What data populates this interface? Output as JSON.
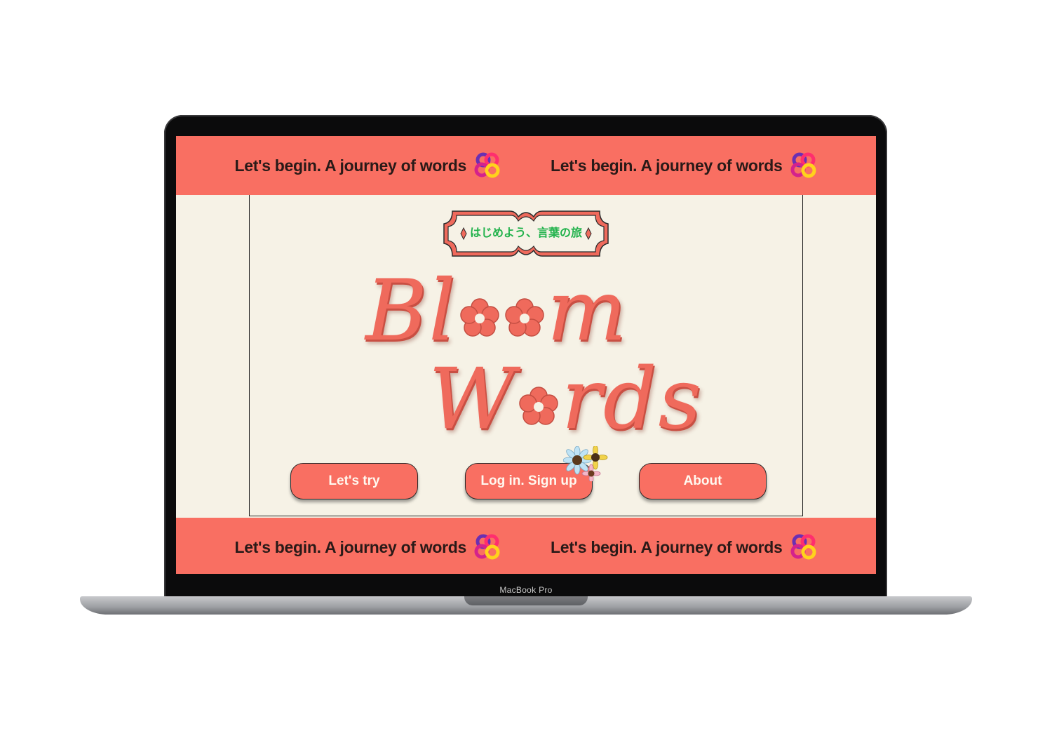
{
  "device": {
    "model_label": "MacBook Pro"
  },
  "ticker": {
    "top": [
      {
        "text": "Let's begin. A journey of words",
        "icon": "knot-flower-icon"
      },
      {
        "text": "Let's begin. A journey of words",
        "icon": "knot-flower-icon"
      }
    ],
    "bottom": [
      {
        "text": "Let's begin. A journey of words",
        "icon": "knot-flower-icon"
      },
      {
        "text": "Let's begin. A journey of words",
        "icon": "knot-flower-icon"
      }
    ]
  },
  "hero": {
    "tagline_jp": "はじめよう、言葉の旅",
    "logo_line1": {
      "before": "Bl",
      "after": "m"
    },
    "logo_line2": {
      "before": "W",
      "after": "rds"
    },
    "logo_alt": "Bloom Words"
  },
  "nav": {
    "lets_try": "Let's try",
    "login_signup": "Log in. Sign up",
    "about": "About"
  },
  "colors": {
    "accent": "#f96f62",
    "background": "#f6f2e6",
    "tagline_green": "#21b24b",
    "text_dark": "#2a1a18"
  }
}
